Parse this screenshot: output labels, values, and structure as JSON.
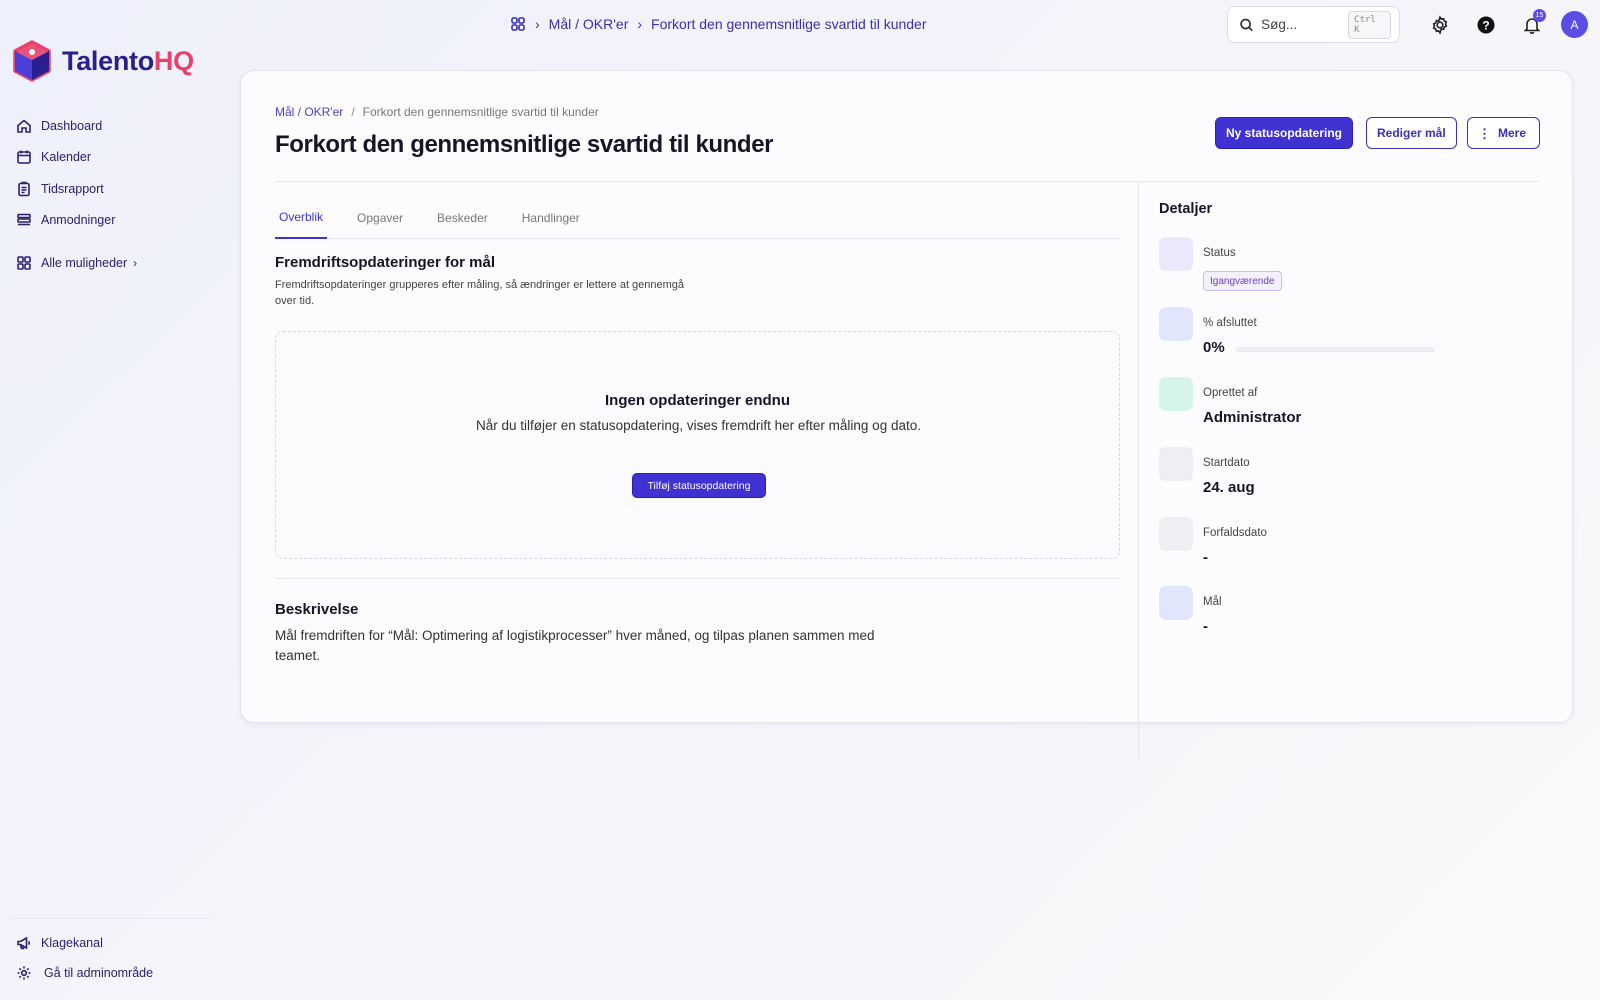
{
  "brand": {
    "name_part1": "Talento",
    "name_part2": "HQ"
  },
  "sidebar": {
    "items": [
      {
        "label": "Dashboard",
        "icon": "home-icon"
      },
      {
        "label": "Kalender",
        "icon": "calendar-icon"
      },
      {
        "label": "Tidsrapport",
        "icon": "clipboard-icon"
      },
      {
        "label": "Anmodninger",
        "icon": "list-icon"
      }
    ],
    "more_label": "Alle muligheder",
    "bottom": [
      {
        "label": "Klagekanal",
        "icon": "megaphone-icon"
      },
      {
        "label": "Gå til adminområde",
        "icon": "gear-icon"
      }
    ]
  },
  "topbar": {
    "crumb_parent": "Mål / OKR'er",
    "crumb_current": "Forkort den gennemsnitlige svartid til kunder",
    "search_placeholder": "Søg...",
    "search_shortcut": "Ctrl K",
    "notification_count": "15",
    "avatar_initial": "A"
  },
  "page": {
    "breadcrumb_parent": "Mål / OKR'er",
    "breadcrumb_sep": "/",
    "breadcrumb_current": "Forkort den gennemsnitlige svartid til kunder",
    "title": "Forkort den gennemsnitlige svartid til kunder",
    "actions": {
      "new_status": "Ny statusopdatering",
      "edit": "Rediger mål",
      "more": "Mere"
    },
    "tabs": [
      "Overblik",
      "Opgaver",
      "Beskeder",
      "Handlinger"
    ],
    "progress_section": {
      "title": "Fremdriftsopdateringer for mål",
      "description": "Fremdriftsopdateringer grupperes efter måling, så ændringer er lettere at gennemgå over tid."
    },
    "empty_state": {
      "title": "Ingen opdateringer endnu",
      "text": "Når du tilføjer en statusopdatering, vises fremdrift her efter måling og dato.",
      "button": "Tilføj statusopdatering"
    },
    "description_section": {
      "title": "Beskrivelse",
      "text": "Mål fremdriften for “Mål: Optimering af logistikprocesser” hver måned, og tilpas planen sammen med teamet."
    }
  },
  "details": {
    "title": "Detaljer",
    "status_label": "Status",
    "status_value": "Igangværende",
    "percent_label": "% afsluttet",
    "percent_value": "0%",
    "percent_fraction": 0,
    "created_by_label": "Oprettet af",
    "created_by_value": "Administrator",
    "start_label": "Startdato",
    "start_value": "24. aug",
    "due_label": "Forfaldsdato",
    "due_value": "-",
    "goal_label": "Mål",
    "goal_value": "-"
  },
  "colors": {
    "accent": "#3f32d0",
    "brand_dark": "#2a1f8f",
    "brand_pink": "#e8416b"
  }
}
